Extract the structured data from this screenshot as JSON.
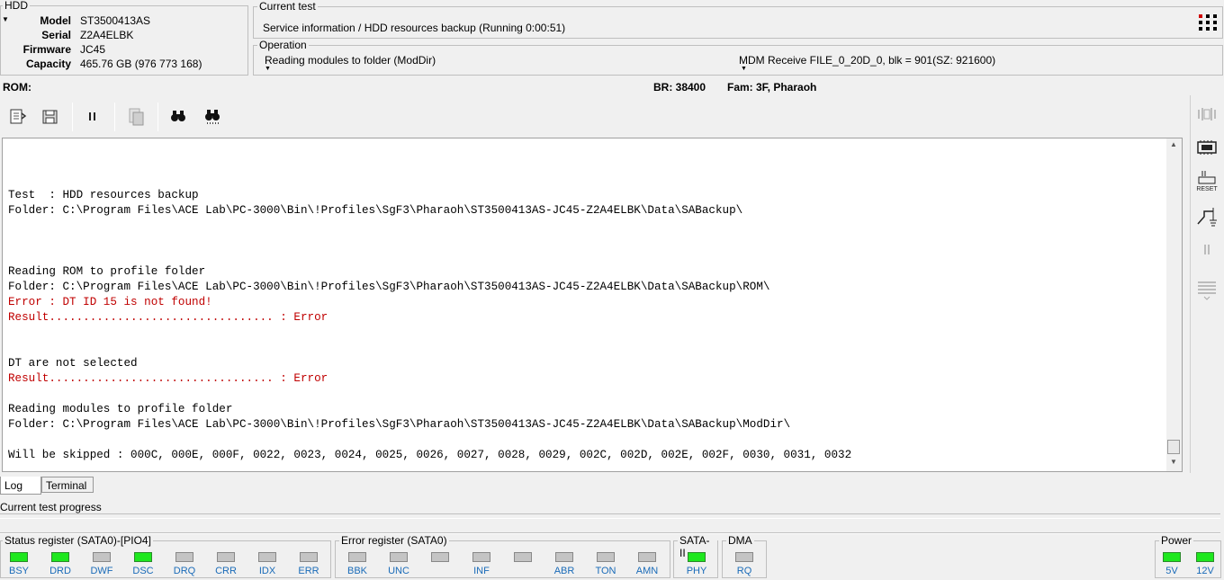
{
  "hdd": {
    "title": "HDD",
    "rows": [
      {
        "label": "Model",
        "value": "ST3500413AS"
      },
      {
        "label": "Serial",
        "value": "Z2A4ELBK"
      },
      {
        "label": "Firmware",
        "value": "JC45"
      },
      {
        "label": "Capacity",
        "value": "465.76 GB (976 773 168)"
      }
    ]
  },
  "current_test": {
    "title": "Current test",
    "value": "Service information / HDD resources backup (Running 0:00:51)"
  },
  "operation": {
    "title": "Operation",
    "left": "Reading modules to folder (ModDir)",
    "right": "MDM Receive FILE_0_20D_0, blk = 901(SZ: 921600)"
  },
  "info_bar": {
    "rom": "ROM:",
    "br": "BR: 38400",
    "fam": "Fam: 3F, Pharaoh"
  },
  "log_lines": [
    {
      "text": "",
      "red": false
    },
    {
      "text": "Test  : HDD resources backup",
      "red": false
    },
    {
      "text": "Folder: C:\\Program Files\\ACE Lab\\PC-3000\\Bin\\!Profiles\\SgF3\\Pharaoh\\ST3500413AS-JC45-Z2A4ELBK\\Data\\SABackup\\",
      "red": false
    },
    {
      "text": "",
      "red": false
    },
    {
      "text": "",
      "red": false
    },
    {
      "text": "",
      "red": false
    },
    {
      "text": "Reading ROM to profile folder",
      "red": false
    },
    {
      "text": "Folder: C:\\Program Files\\ACE Lab\\PC-3000\\Bin\\!Profiles\\SgF3\\Pharaoh\\ST3500413AS-JC45-Z2A4ELBK\\Data\\SABackup\\ROM\\",
      "red": false
    },
    {
      "text": "Error : DT ID 15 is not found!",
      "red": true
    },
    {
      "text": "Result................................. : Error",
      "red": true
    },
    {
      "text": "",
      "red": false
    },
    {
      "text": "",
      "red": false
    },
    {
      "text": "DT are not selected",
      "red": false
    },
    {
      "text": "Result................................. : Error",
      "red": true
    },
    {
      "text": "",
      "red": false
    },
    {
      "text": "Reading modules to profile folder",
      "red": false
    },
    {
      "text": "Folder: C:\\Program Files\\ACE Lab\\PC-3000\\Bin\\!Profiles\\SgF3\\Pharaoh\\ST3500413AS-JC45-Z2A4ELBK\\Data\\SABackup\\ModDir\\",
      "red": false
    },
    {
      "text": "",
      "red": false
    },
    {
      "text": "Will be skipped : 000C, 000E, 000F, 0022, 0023, 0024, 0025, 0026, 0027, 0028, 0029, 002C, 002D, 002E, 002F, 0030, 0031, 0032",
      "red": false
    }
  ],
  "tabs": {
    "log": "Log",
    "terminal": "Terminal"
  },
  "progress_label": "Current test progress",
  "status_register": {
    "title": "Status register (SATA0)-[PIO4]",
    "leds": [
      {
        "label": "BSY",
        "on": true
      },
      {
        "label": "DRD",
        "on": true
      },
      {
        "label": "DWF",
        "on": false
      },
      {
        "label": "DSC",
        "on": true
      },
      {
        "label": "DRQ",
        "on": false
      },
      {
        "label": "CRR",
        "on": false
      },
      {
        "label": "IDX",
        "on": false
      },
      {
        "label": "ERR",
        "on": false
      }
    ]
  },
  "error_register": {
    "title": "Error register (SATA0)",
    "leds": [
      {
        "label": "BBK",
        "on": false
      },
      {
        "label": "UNC",
        "on": false
      },
      {
        "label": "",
        "on": false
      },
      {
        "label": "INF",
        "on": false
      },
      {
        "label": "",
        "on": false
      },
      {
        "label": "ABR",
        "on": false
      },
      {
        "label": "TON",
        "on": false
      },
      {
        "label": "AMN",
        "on": false
      }
    ]
  },
  "sata": {
    "title": "SATA-II",
    "label": "PHY",
    "on": true
  },
  "dma": {
    "title": "DMA",
    "label": "RQ",
    "on": false
  },
  "power": {
    "title": "Power",
    "leds": [
      {
        "label": "5V",
        "on": true
      },
      {
        "label": "12V",
        "on": true
      }
    ]
  },
  "colors": {
    "led_on": "#1ee81e",
    "led_off": "#c4c4c4",
    "error_text": "#c00000",
    "led_label": "#1a6bb8"
  },
  "icons": [
    "open-profile-icon",
    "save-icon",
    "pause-icon",
    "copy-icon",
    "binoculars-icon",
    "binoculars-next-icon",
    "menu-grid-icon",
    "reset-icon",
    "power-switch-icon",
    "list-icon"
  ]
}
